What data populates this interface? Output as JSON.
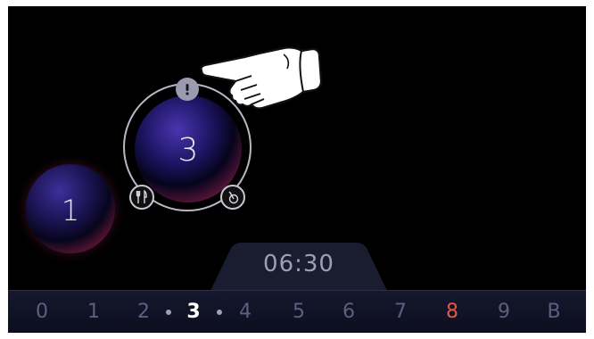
{
  "zones": {
    "left": {
      "level": "1"
    },
    "selected": {
      "level": "3"
    }
  },
  "icons": {
    "alert": "exclamation-icon",
    "left_button": "cutlery-icon",
    "right_button": "timer-icon",
    "pointer": "pointing-hand-icon"
  },
  "timer": {
    "value": "06:30"
  },
  "power_scale": {
    "levels": [
      "0",
      "1",
      "2",
      "3",
      "4",
      "5",
      "6",
      "7",
      "8",
      "9",
      "B"
    ],
    "selected": "3",
    "highlighted": "8"
  },
  "colors": {
    "background": "#000000",
    "zone_ring": "#b8b8c4",
    "highlight": "#e05a4a",
    "scale_inactive": "#5a6080",
    "timer_text": "#9aa0b8"
  }
}
